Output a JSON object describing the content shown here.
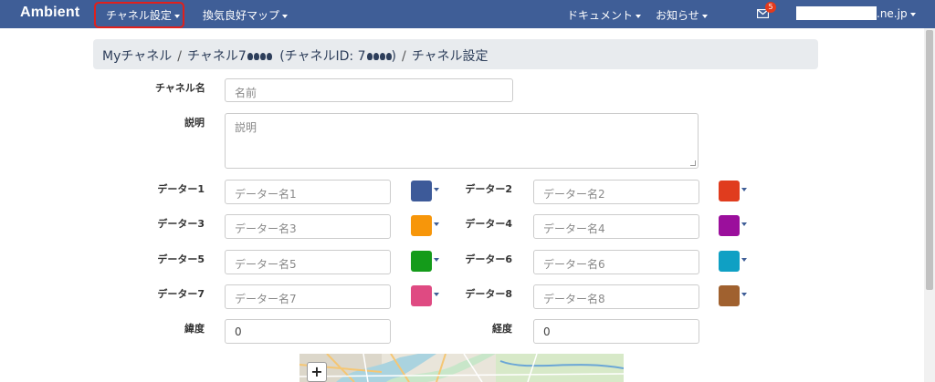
{
  "nav": {
    "brand": "Ambient",
    "channel_settings": "チャネル設定",
    "ventilation_map": "換気良好マップ",
    "documents": "ドキュメント",
    "news": "お知らせ",
    "mail_count": "5",
    "user_suffix": ".ne.jp"
  },
  "breadcrumb": {
    "my_channels": "Myチャネル",
    "channel_prefix": "チャネル7",
    "channel_id_prefix": "(チャネルID: 7",
    "channel_id_suffix": ")",
    "current": "チャネル設定"
  },
  "form": {
    "name_label": "チャネル名",
    "name_placeholder": "名前",
    "desc_label": "説明",
    "desc_placeholder": "説明",
    "data": [
      {
        "label": "データー1",
        "placeholder": "データー名1",
        "color": "#3d5a99"
      },
      {
        "label": "データー2",
        "placeholder": "データー名2",
        "color": "#e03c1e"
      },
      {
        "label": "データー3",
        "placeholder": "データー名3",
        "color": "#f7960a"
      },
      {
        "label": "データー4",
        "placeholder": "データー名4",
        "color": "#9b0f9c"
      },
      {
        "label": "データー5",
        "placeholder": "データー名5",
        "color": "#149b1a"
      },
      {
        "label": "データー6",
        "placeholder": "データー名6",
        "color": "#0fa0c4"
      },
      {
        "label": "データー7",
        "placeholder": "データー名7",
        "color": "#df4a82"
      },
      {
        "label": "データー8",
        "placeholder": "データー名8",
        "color": "#a0612f"
      }
    ],
    "lat_label": "緯度",
    "lat_value": "0",
    "lng_label": "経度",
    "lng_value": "0"
  },
  "map": {
    "zoom_in": "+"
  }
}
